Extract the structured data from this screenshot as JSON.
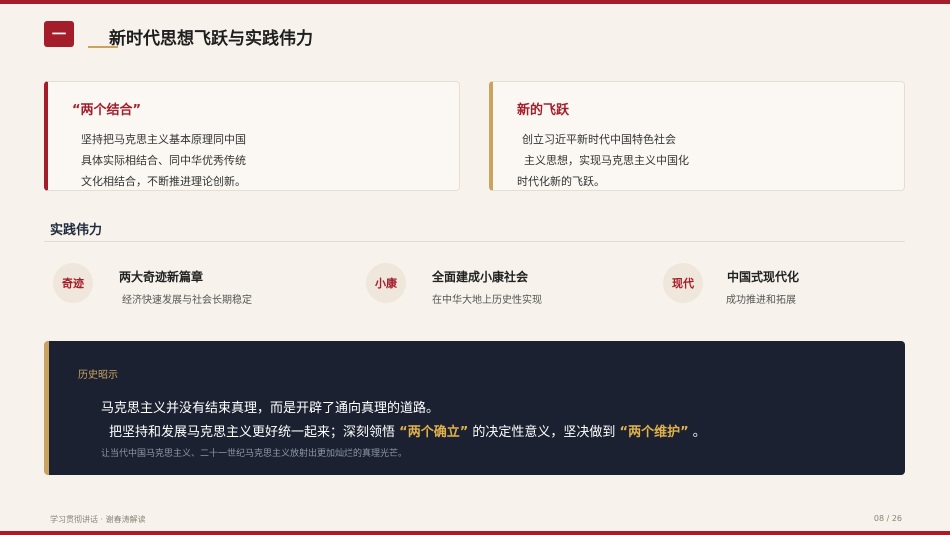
{
  "header": {
    "section_number": "一",
    "title": "新时代思想飞跃与实践伟力"
  },
  "cards": [
    {
      "title": "“两个结合”",
      "lines": [
        "坚持把马克思主义基本原理同中国",
        "具体实际相结合、同中华优秀传统",
        "文化相结合，不断推进理论创新。"
      ]
    },
    {
      "title": "新的飞跃",
      "lines": [
        "创立习近平新时代中国特色社会",
        "主义思想，实现马克思主义中国化",
        "时代化新的飞跃。"
      ]
    }
  ],
  "practice": {
    "heading": "实践伟力",
    "items": [
      {
        "badge": "奇迹",
        "title": "两大奇迹新篇章",
        "desc": "经济快速发展与社会长期稳定"
      },
      {
        "badge": "小康",
        "title": "全面建成小康社会",
        "desc": "在中华大地上历史性实现"
      },
      {
        "badge": "现代",
        "title": "中国式现代化",
        "desc": "成功推进和拓展"
      }
    ]
  },
  "insight": {
    "label": "历史昭示",
    "line1": "马克思主义并没有结束真理，而是开辟了通向真理的道路。",
    "line2_a": "把坚持和发展马克思主义更好统一起来；深刻领悟",
    "line2_b": "“两个确立”",
    "line2_c": "的决定性意义，坚决做到",
    "line2_d": "“两个维护”",
    "line2_e": "。",
    "line3": "让当代中国马克思主义、二十一世纪马克思主义放射出更加灿烂的真理光芒。"
  },
  "footer": {
    "left": "学习贯彻讲话 · 谢春涛解读",
    "page": "08 / 26"
  },
  "colors": {
    "accent_red": "#a31d2b",
    "accent_gold": "#c9a35f",
    "dark_panel": "#1b2130"
  }
}
